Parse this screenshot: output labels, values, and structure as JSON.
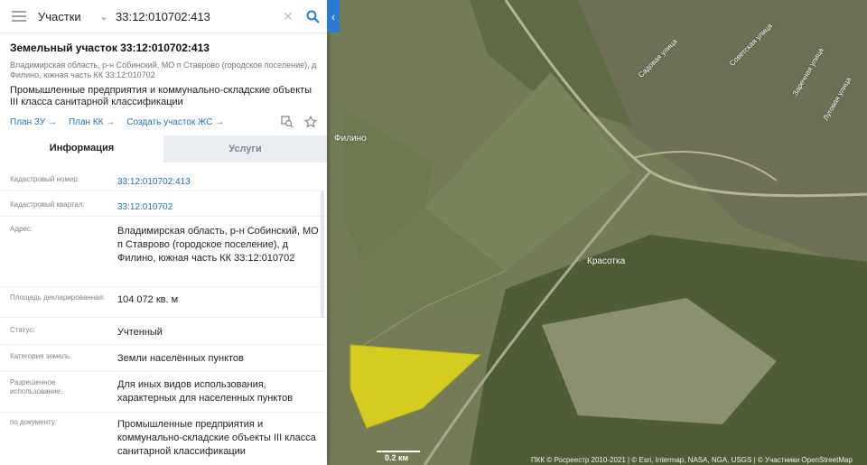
{
  "search": {
    "category": "Участки",
    "query": "33:12:010702:413"
  },
  "parcel": {
    "title": "Земельный участок 33:12:010702:413",
    "address_small": "Владимирская область, р-н Собинский, МО п Ставрово (городское поселение), д Филино, южная часть КК 33:12:010702",
    "purpose": "Промышленные предприятия и коммунально-складские объекты III класса санитарной классификации",
    "links": [
      "План ЗУ →",
      "План КК →",
      "Создать участок ЖС →"
    ]
  },
  "tabs": [
    "Информация",
    "Услуги"
  ],
  "info": [
    {
      "label": "Кадастровый номер:",
      "value": "33:12:010702:413"
    },
    {
      "label": "Кадастровый квартал:",
      "value": "33:12:010702"
    },
    {
      "label": "Адрес:",
      "value": "Владимирская область, р-н Собинский, МО п Ставрово (городское поселение), д Филино, южная часть КК 33:12:010702"
    },
    {
      "label": "Площадь декларированная:",
      "value": "104 072 кв. м"
    },
    {
      "label": "Статус:",
      "value": "Учтенный"
    },
    {
      "label": "Категория земель:",
      "value": "Земли населённых пунктов"
    },
    {
      "label": "Разрешенное использование:",
      "value": "Для иных видов использования, характерных для населенных пунктов"
    },
    {
      "label": "по документу:",
      "value": "Промышленные предприятия и коммунально-складские объекты III класса санитарной классификации"
    }
  ],
  "map": {
    "place_filino": "Филино",
    "place_krasotka": "Красотка",
    "street_1": "Садовая улица",
    "street_2": "Советская улица",
    "street_3": "Заречная улица",
    "street_4": "Луговая улица",
    "scale": "0.2 км",
    "copyright": "ПКК © Росреестр 2010-2021 | © Esri, Intermap, NASA, NGA, USGS | © Участники OpenStreetMap",
    "highlight_color": "#d4cc1e"
  },
  "icons": {
    "menu": "hamburger-icon",
    "dropdown": "chevron-down-icon",
    "clear": "close-icon",
    "search": "search-icon",
    "collapse": "chevron-left-icon",
    "zoom": "zoom-to-icon",
    "favorite": "star-icon"
  }
}
